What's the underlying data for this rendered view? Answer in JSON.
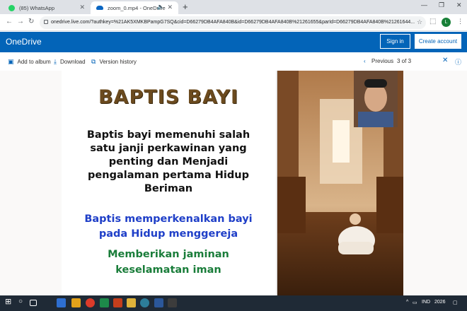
{
  "browser": {
    "tabs": [
      {
        "label": "(85) WhatsApp",
        "icon": "whatsapp-icon"
      },
      {
        "label": "zoom_0.mp4 - OneDrive",
        "icon": "onedrive-icon"
      }
    ],
    "url": "onedrive.live.com/?authkey=%21AK5XMKBPampG7SQ&cid=D66279DB4AFA840B&id=D66279DB4AFA840B%21261655&parId=D66279DB4AFA840B%21261644...",
    "profile_initial": "L"
  },
  "onedrive": {
    "brand": "OneDrive",
    "sign_in_label": "Sign in",
    "create_account_label": "Create account",
    "commands": {
      "add_to_album": "Add to album",
      "download": "Download",
      "version_history": "Version history"
    },
    "pager": {
      "previous_label": "Previous",
      "position": "3 of 3"
    }
  },
  "slide": {
    "title": "BAPTIS BAYI",
    "black_lines": [
      "Baptis bayi memenuhi salah",
      "satu janji perkawinan yang",
      "penting dan Menjadi",
      "pengalaman pertama Hidup",
      "Beriman"
    ],
    "blue_lines": [
      "Baptis memperkenalkan bayi",
      "pada Hidup menggereja"
    ],
    "green_lines": [
      "Memberikan jaminan",
      "keselamatan iman"
    ]
  },
  "taskbar": {
    "language": "IND",
    "clock": "2026"
  },
  "colors": {
    "onedrive_blue": "#0364b8",
    "title_brown": "#6b4a1e",
    "text_blue": "#1f3fc8",
    "text_green": "#1a7d3a",
    "taskbar": "#1f2a36"
  }
}
